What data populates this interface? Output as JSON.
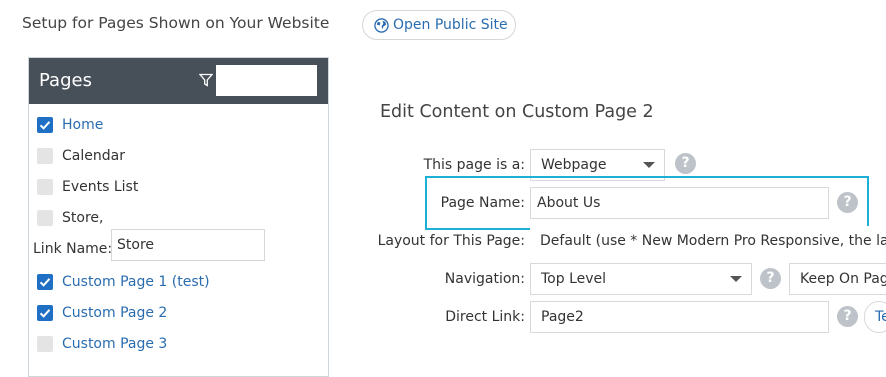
{
  "header": {
    "title": "Setup for Pages Shown on Your Website",
    "public_site_button": "Open Public Site",
    "public_site_icon": "globe-icon"
  },
  "sidebar": {
    "title": "Pages",
    "filter_icon": "filter-icon",
    "filter_value": "",
    "items": [
      {
        "label": "Home",
        "checked": true
      },
      {
        "label": "Calendar",
        "checked": false
      },
      {
        "label": "Events List",
        "checked": false
      },
      {
        "label": "Store,",
        "checked": false
      },
      {
        "label": "Custom Page 1 (test)",
        "checked": true
      },
      {
        "label": "Custom Page 2",
        "checked": true
      },
      {
        "label": "Custom Page 3",
        "checked": false
      }
    ],
    "link_name_label": "Link Name:",
    "link_name_value": "Store"
  },
  "editor": {
    "title": "Edit Content on Custom Page 2",
    "page_type_label": "This page is a:",
    "page_type_value": "Webpage",
    "page_name_label": "Page Name:",
    "page_name_value": "About Us",
    "layout_label": "Layout for This Page:",
    "layout_value": "Default (use * New Modern Pro Responsive, the lay",
    "navigation_label": "Navigation:",
    "navigation_value": "Top Level",
    "navigation_extra": "Keep On Pag",
    "direct_link_label": "Direct Link:",
    "direct_link_value": "Page2",
    "direct_link_extra": "Te",
    "help_glyph": "?"
  },
  "colors": {
    "sidebar_header": "#474f59",
    "link": "#2a6cb0",
    "checkbox_checked": "#1f6fc4",
    "highlight": "#1bb0d4",
    "help_icon": "#bdc3c9"
  }
}
